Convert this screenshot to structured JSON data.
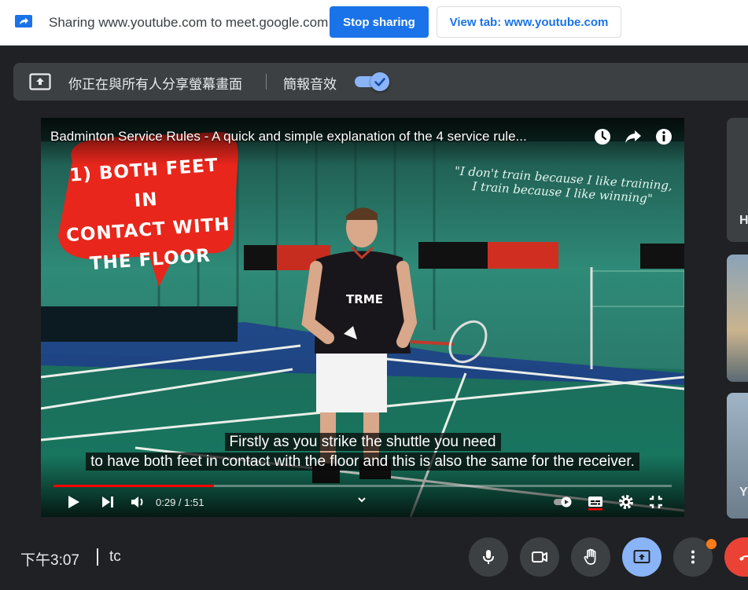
{
  "share_bar": {
    "text": "Sharing www.youtube.com to meet.google.com",
    "stop_label": "Stop sharing",
    "view_label": "View tab: www.youtube.com"
  },
  "banner": {
    "presenting_text": "你正在與所有人分享螢幕畫面",
    "audio_label": "簡報音效",
    "audio_enabled": true
  },
  "video": {
    "title": "Badminton Service Rules - A quick and simple explanation of the 4 service rule...",
    "bubble_lines": [
      "1) BOTH FEET IN",
      "CONTACT WITH",
      "THE FLOOR"
    ],
    "quote_lines": [
      "\"I don't train because I like training,",
      "I train because I like winning\""
    ],
    "shirt_logo": "TRME",
    "caption_lines": [
      "Firstly as you strike the shuttle you need",
      "to have both feet in contact with the floor and this is also the same for the receiver."
    ],
    "time": "0:29 / 1:51",
    "progress_fraction": 0.26
  },
  "side_tiles": {
    "tile1_letter": "H",
    "tile3_letter": "Y"
  },
  "bottom": {
    "clock": "下午3:07",
    "meeting_code": "tc"
  },
  "colors": {
    "accent": "#1a73e8",
    "active": "#8ab4f8",
    "leave": "#ea4335",
    "notify": "#fa7b17",
    "progress": "#ff0000"
  }
}
